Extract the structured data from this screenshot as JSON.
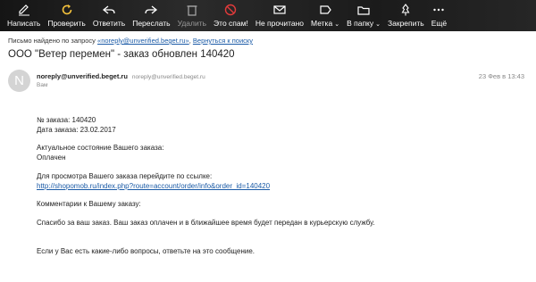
{
  "toolbar": {
    "items": [
      {
        "label": "Написать",
        "icon": "compose-icon"
      },
      {
        "label": "Проверить",
        "icon": "refresh-icon"
      },
      {
        "label": "Ответить",
        "icon": "reply-icon"
      },
      {
        "label": "Переслать",
        "icon": "forward-icon"
      },
      {
        "label": "Удалить",
        "icon": "trash-icon"
      },
      {
        "label": "Это спам!",
        "icon": "spam-icon"
      },
      {
        "label": "Не прочитано",
        "icon": "envelope-icon"
      },
      {
        "label": "Метка",
        "icon": "label-icon"
      },
      {
        "label": "В папку",
        "icon": "folder-icon"
      },
      {
        "label": "Закрепить",
        "icon": "pin-icon"
      },
      {
        "label": "Ещё",
        "icon": "more-icon"
      }
    ]
  },
  "search": {
    "prefix": "Письмо найдено по запросу",
    "query": "«noreply@unverified.beget.ru»",
    "back": "Вернуться к поиску"
  },
  "subject": "ООО \"Ветер перемен\" - заказ обновлен 140420",
  "sender": {
    "avatar_letter": "N",
    "name": "noreply@unverified.beget.ru",
    "email": "noreply@unverified.beget.ru",
    "recipient": "Вам",
    "date": "23 Фев в 13:43"
  },
  "body": {
    "order_no": "№ заказа: 140420",
    "order_date": "Дата заказа: 23.02.2017",
    "status_label": "Актуальное состояние Вашего заказа:",
    "status_value": "Оплачен",
    "link_label": "Для просмотра Вашего заказа перейдите по ссылке:",
    "link": "http://shopomob.ru/index.php?route=account/order/info&order_id=140420",
    "comments_label": "Комментарии к Вашему заказу:",
    "comment": "Спасибо за ваш заказ. Ваш заказ оплачен и в ближайшее время будет передан в курьерскую службу.",
    "footer": "Если у Вас есть какие-либо вопросы, ответьте на это сообщение."
  },
  "colors": {
    "toolbar_bg": "#1e1e1e",
    "link": "#1a5aa6",
    "refresh_icon": "#f5c23c",
    "spam_icon": "#e23b3b"
  }
}
